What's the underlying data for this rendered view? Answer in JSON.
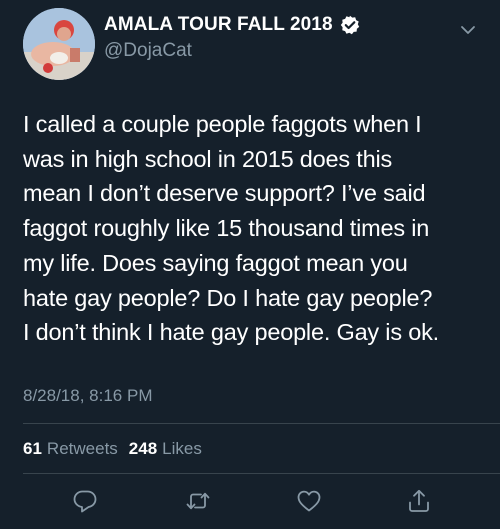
{
  "tweet": {
    "author": {
      "display_name": "AMALA TOUR FALL 2018",
      "handle": "@DojaCat",
      "verified": true
    },
    "text": "I called a couple people faggots when I\nwas in high school in 2015 does this\nmean I don’t deserve support? I’ve said\nfaggot roughly like 15 thousand times in\nmy life. Does saying faggot mean you\nhate gay people? Do I hate gay people?\nI don’t think I hate gay people. Gay is ok.",
    "timestamp": "8/28/18, 8:16 PM",
    "stats": {
      "retweets_count": "61",
      "retweets_label": "Retweets",
      "likes_count": "248",
      "likes_label": "Likes"
    }
  },
  "icons": {
    "more": "chevron-down-icon",
    "verified": "verified-badge-icon",
    "reply": "reply-icon",
    "retweet": "retweet-icon",
    "like": "heart-icon",
    "share": "share-icon"
  },
  "colors": {
    "background": "#15202b",
    "primary_text": "#ffffff",
    "secondary_text": "#8899a6",
    "divider": "#38444d",
    "verified_badge": "#ffffff"
  }
}
